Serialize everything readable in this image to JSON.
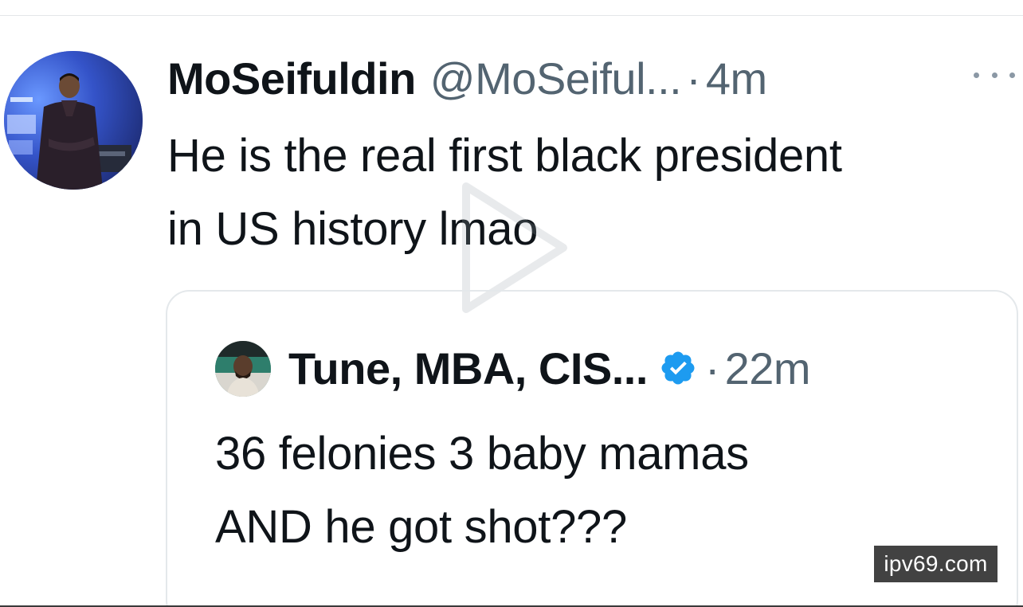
{
  "tweet": {
    "display_name": "MoSeifuldin",
    "handle": "@MoSeiful...",
    "separator": "·",
    "time": "4m",
    "text_line1": "He is the real first black president",
    "text_line2": "in US history lmao",
    "more_icon": "more-horizontal-icon"
  },
  "quoted_tweet": {
    "display_name": "Tune, MBA, CIS...",
    "verified_icon": "verified-badge-icon",
    "verified_color": "#1d9bf0",
    "separator": "·",
    "time": "22m",
    "text_line1": "36 felonies 3 baby mamas",
    "text_line2": "AND he got shot???"
  },
  "overlay": {
    "play_icon": "play-icon"
  },
  "watermark": {
    "text": "ipv69.com"
  },
  "colors": {
    "text_primary": "#0f1419",
    "text_secondary": "#536471",
    "border": "#e4e8eb"
  }
}
